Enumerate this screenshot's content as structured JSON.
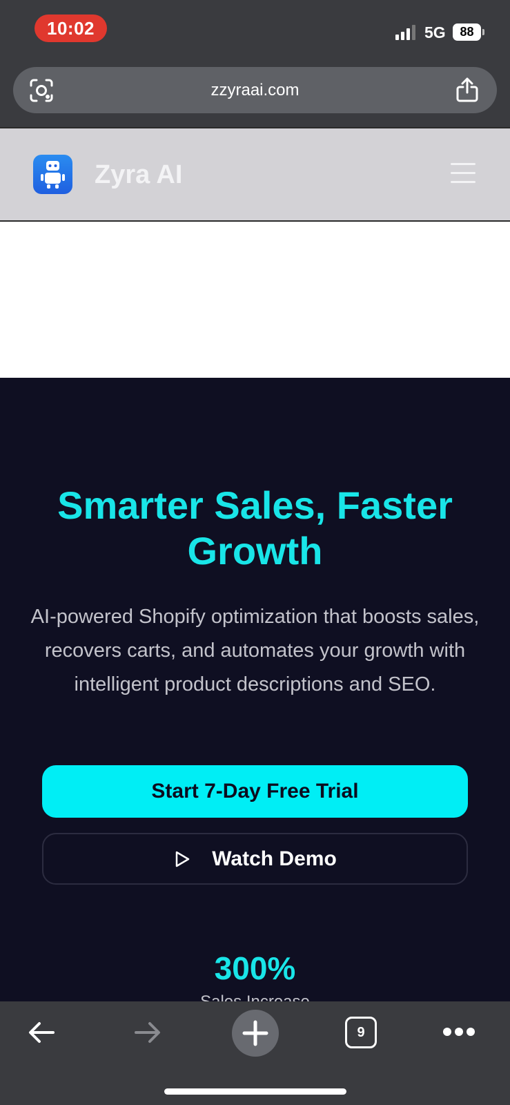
{
  "status_bar": {
    "time": "10:02",
    "network": "5G",
    "battery": "88"
  },
  "browser": {
    "url": "zzyraai.com",
    "tab_count": "9",
    "icons": {
      "lens": "lens-scan-icon",
      "share": "share-icon",
      "back": "back-arrow-icon",
      "forward": "forward-arrow-icon",
      "new_tab": "plus-icon",
      "more": "more-dots-icon"
    }
  },
  "site_header": {
    "brand": "Zyra AI",
    "logo": "robot-logo",
    "menu_icon": "hamburger-menu-icon"
  },
  "hero": {
    "title": "Smarter Sales, Faster Growth",
    "subtitle": "AI-powered Shopify optimization that boosts sales, recovers carts, and automates your growth with intelligent product descriptions and SEO.",
    "primary_cta": "Start 7-Day Free Trial",
    "secondary_cta": "Watch Demo"
  },
  "stats": {
    "value": "300%",
    "label": "Sales Increase"
  },
  "colors": {
    "accent": "#00EEF5",
    "hero_background": "#0F0F22",
    "time_pill": "#E0382E"
  }
}
